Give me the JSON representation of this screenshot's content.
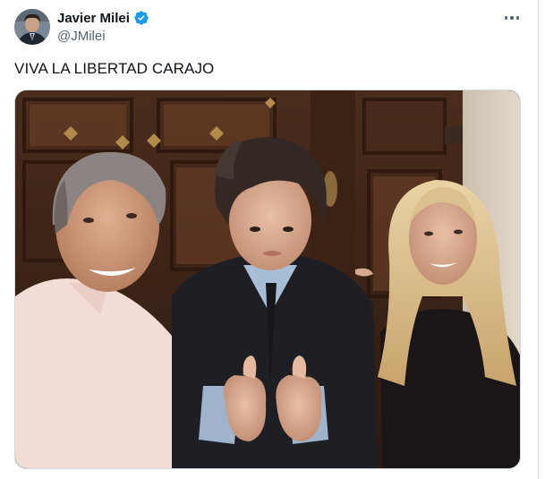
{
  "author": {
    "display_name": "Javier Milei",
    "handle": "@JMilei",
    "verified": true,
    "avatar": "user-avatar",
    "verified_icon": "verified-badge-icon",
    "verified_color": "#1d9bf0"
  },
  "menu": {
    "icon": "more-options-icon"
  },
  "post": {
    "text": "VIVA LA LIBERTAD CARAJO"
  },
  "media": {
    "type": "photo",
    "subject": "three-person selfie in front of carved wooden doors"
  }
}
